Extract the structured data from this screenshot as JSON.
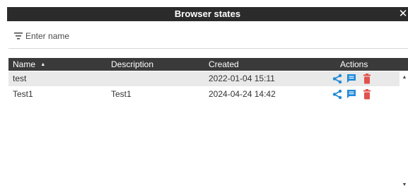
{
  "dialog": {
    "title": "Browser states"
  },
  "filter": {
    "placeholder": "Enter name",
    "value": ""
  },
  "table": {
    "columns": [
      "Name",
      "Description",
      "Created",
      "Actions"
    ],
    "sort_indicator": "▲",
    "rows": [
      {
        "name": "test",
        "description": "",
        "created": "2022-01-04 15:11"
      },
      {
        "name": "Test1",
        "description": "Test1",
        "created": "2024-04-24 14:42"
      }
    ]
  },
  "icons": {
    "close": "close-icon",
    "filter": "filter-icon",
    "share": "share-icon",
    "comment": "comment-icon",
    "delete": "delete-icon"
  },
  "colors": {
    "titlebar": "#2b2b2b",
    "header": "#3a3a3a",
    "row_alt": "#e9e9e9",
    "action_blue": "#1e8ad8",
    "delete_red": "#e0524c"
  }
}
